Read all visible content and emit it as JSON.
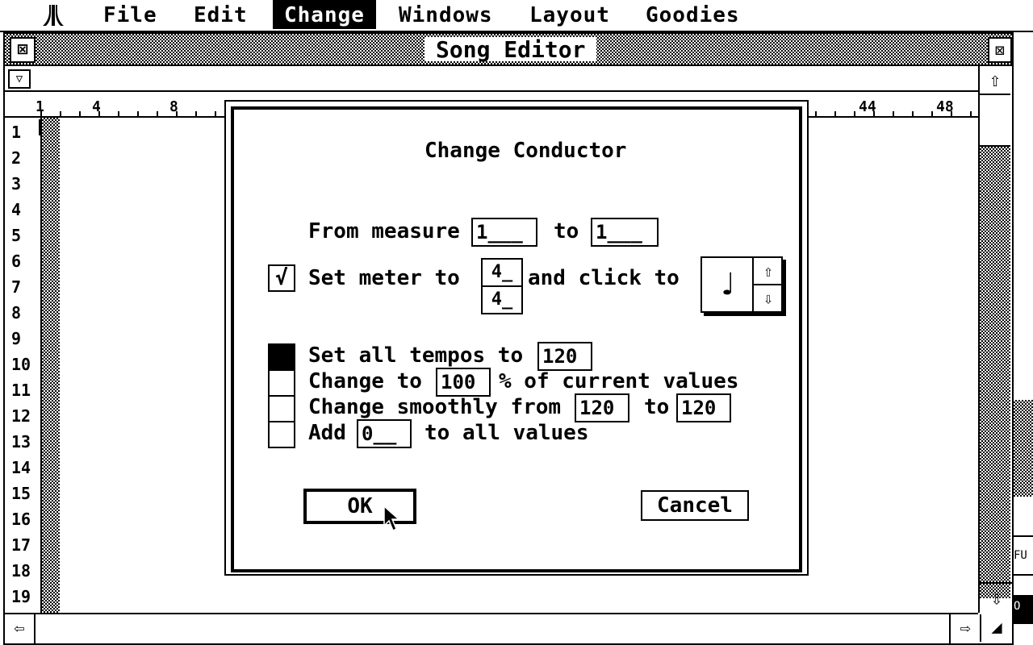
{
  "menubar": {
    "logo": "atari-fuji-logo",
    "items": [
      "File",
      "Edit",
      "Change",
      "Windows",
      "Layout",
      "Goodies"
    ],
    "active": "Change"
  },
  "window": {
    "title": "Song Editor",
    "closer_icon": "close-icon",
    "fuller_icon": "fuller-icon",
    "ruler_labels": [
      "1",
      "4",
      "8",
      "44",
      "48"
    ],
    "track_numbers": [
      "1",
      "2",
      "3",
      "4",
      "5",
      "6",
      "7",
      "8",
      "9",
      "10",
      "11",
      "12",
      "13",
      "14",
      "15",
      "16",
      "17",
      "18",
      "19"
    ]
  },
  "dialog": {
    "title": "Change Conductor",
    "from_measure_label": "From measure",
    "from_measure_value": "1___",
    "to_label": "to",
    "to_measure_value": "1___",
    "set_meter_checked": true,
    "set_meter_check_glyph": "√",
    "set_meter_label": "Set meter to",
    "meter_numerator": "4_",
    "meter_denominator": "4_",
    "and_click_label": "and click to",
    "click_note": "♩",
    "options": [
      {
        "selected": true,
        "parts": [
          "Set all tempos to",
          "120"
        ]
      },
      {
        "selected": false,
        "parts": [
          "Change to",
          "100",
          "% of current values"
        ]
      },
      {
        "selected": false,
        "parts": [
          "Change smoothly from",
          "120",
          "to",
          "120"
        ]
      },
      {
        "selected": false,
        "parts": [
          "Add",
          "0__",
          "to all values"
        ]
      }
    ],
    "ok_label": "OK",
    "cancel_label": "Cancel"
  },
  "background": {
    "right_edge_fragment_1": "FU",
    "right_edge_fragment_2": "O"
  }
}
